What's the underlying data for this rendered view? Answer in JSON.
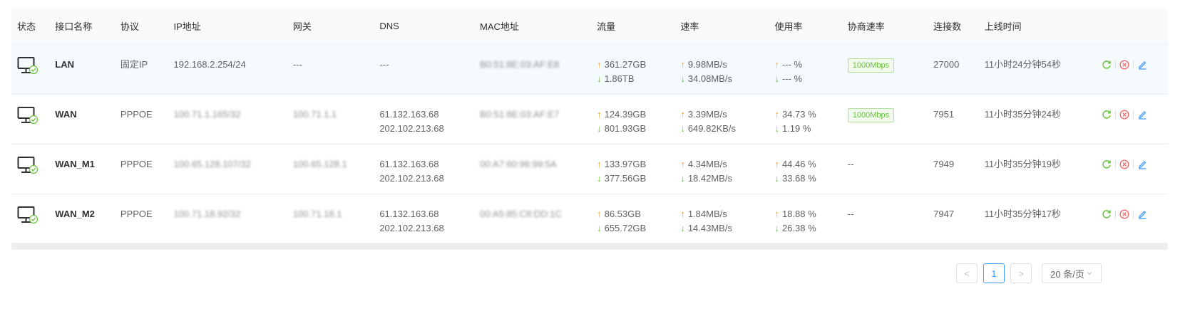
{
  "columns": [
    "状态",
    "接口名称",
    "协议",
    "IP地址",
    "网关",
    "DNS",
    "MAC地址",
    "流量",
    "速率",
    "使用率",
    "协商速率",
    "连接数",
    "上线时间"
  ],
  "rows": [
    {
      "name": "LAN",
      "protocol": "固定IP",
      "ip": "192.168.2.254/24",
      "gateway": "---",
      "dns1": "---",
      "dns2": "",
      "mac": "B0:51:8E:03:AF:E8",
      "traffic_up": "361.27GB",
      "traffic_down": "1.86TB",
      "rate_up": "9.98MB/s",
      "rate_down": "34.08MB/s",
      "usage_up": "--- %",
      "usage_down": "--- %",
      "negotiated": "1000Mbps",
      "connections": "27000",
      "uptime": "11小时24分钟54秒"
    },
    {
      "name": "WAN",
      "protocol": "PPPOE",
      "ip": "100.71.1.165/32",
      "gateway": "100.71.1.1",
      "dns1": "61.132.163.68",
      "dns2": "202.102.213.68",
      "mac": "B0:51:8E:03:AF:E7",
      "traffic_up": "124.39GB",
      "traffic_down": "801.93GB",
      "rate_up": "3.39MB/s",
      "rate_down": "649.82KB/s",
      "usage_up": "34.73 %",
      "usage_down": "1.19 %",
      "negotiated": "1000Mbps",
      "connections": "7951",
      "uptime": "11小时35分钟24秒"
    },
    {
      "name": "WAN_M1",
      "protocol": "PPPOE",
      "ip": "100.65.128.107/32",
      "gateway": "100.65.128.1",
      "dns1": "61.132.163.68",
      "dns2": "202.102.213.68",
      "mac": "00:A7:60:96:99:5A",
      "traffic_up": "133.97GB",
      "traffic_down": "377.56GB",
      "rate_up": "4.34MB/s",
      "rate_down": "18.42MB/s",
      "usage_up": "44.46 %",
      "usage_down": "33.68 %",
      "negotiated": "--",
      "connections": "7949",
      "uptime": "11小时35分钟19秒"
    },
    {
      "name": "WAN_M2",
      "protocol": "PPPOE",
      "ip": "100.71.18.92/32",
      "gateway": "100.71.18.1",
      "dns1": "61.132.163.68",
      "dns2": "202.102.213.68",
      "mac": "00:A5:85:C8:DD:1C",
      "traffic_up": "86.53GB",
      "traffic_down": "655.72GB",
      "rate_up": "1.84MB/s",
      "rate_down": "14.43MB/s",
      "usage_up": "18.88 %",
      "usage_down": "26.38 %",
      "negotiated": "--",
      "connections": "7947",
      "uptime": "11小时35分钟17秒"
    }
  ],
  "pagination": {
    "prev": "<",
    "current": "1",
    "next": ">",
    "page_size": "20 条/页"
  },
  "icons": {
    "status": "monitor-check-icon",
    "refresh": "refresh-icon",
    "disconnect": "disconnect-icon",
    "edit": "edit-icon"
  },
  "colors": {
    "up": "#f0a020",
    "down": "#67c23a",
    "link": "#409eff",
    "danger": "#f56c6c",
    "badge": "#67c23a"
  }
}
